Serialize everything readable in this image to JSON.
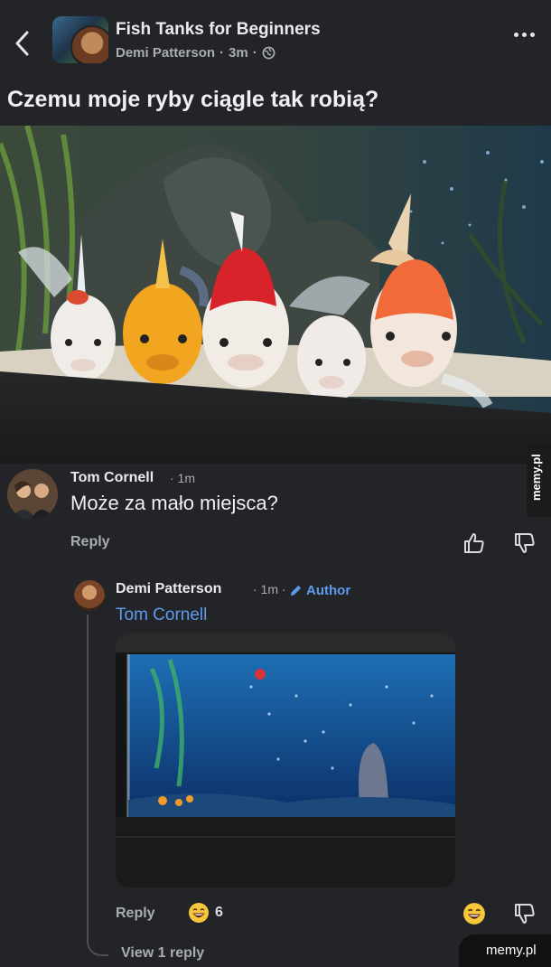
{
  "header": {
    "group_name": "Fish Tanks for Beginners",
    "author": "Demi Patterson",
    "time": "3m",
    "separator": "·"
  },
  "post": {
    "title": "Czemu moje ryby ciągle tak robią?"
  },
  "watermarks": {
    "side": "memy.pl",
    "corner": "memy.pl"
  },
  "comment": {
    "author": "Tom Cornell",
    "time": "· 1m",
    "text": "Może za mało miejsca?",
    "reply_label": "Reply"
  },
  "reply": {
    "author": "Demi Patterson",
    "time": "· 1m ·",
    "badge": "Author",
    "mention": "Tom Cornell",
    "reply_label": "Reply",
    "reaction_count": "6",
    "view_replies": "View 1 reply"
  },
  "icons": {
    "back": "back-arrow-icon",
    "more": "more-options-icon",
    "globe": "globe-icon",
    "like": "thumbs-up-icon",
    "dislike": "thumbs-down-icon",
    "pencil": "pencil-icon",
    "laugh": "laugh-emoji-icon"
  },
  "colors": {
    "background": "#232427",
    "link": "#5d9cec",
    "muted": "#a9acb2"
  }
}
